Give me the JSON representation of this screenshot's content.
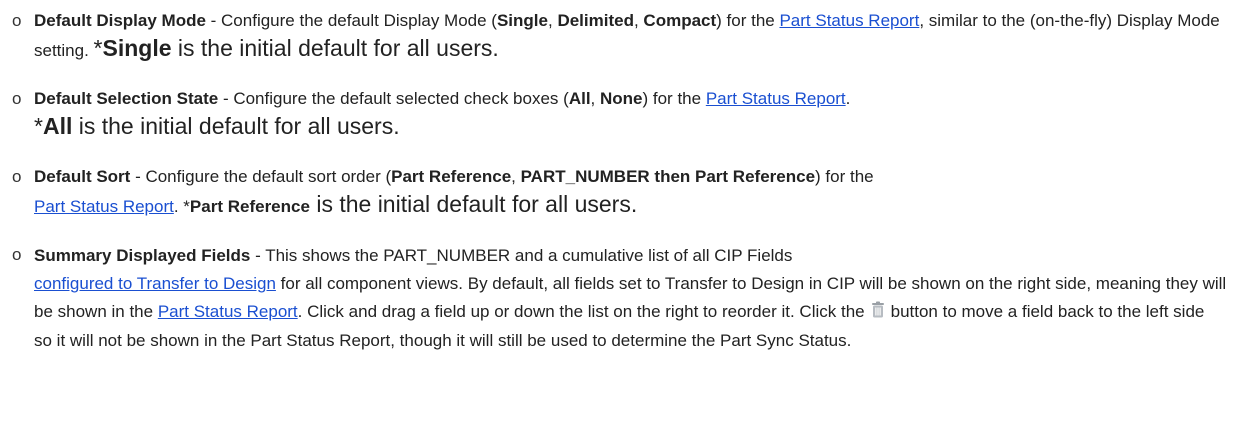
{
  "items": [
    {
      "title": "Default Display Mode",
      "sep": " - ",
      "t1": "Configure the default Display Mode (",
      "opt1": "Single",
      "c1": ", ",
      "opt2": "Delimited",
      "c2": ", ",
      "opt3": "Compact",
      "t2": ") for the ",
      "link": "Part Status Report",
      "t3": ", similar to the (on-the-fly) Display Mode setting. ",
      "note_prefix": "*",
      "note_bold": "Single",
      "note_rest": " is the initial default for all users."
    },
    {
      "title": "Default Selection State",
      "sep": " - ",
      "t1": "Configure the default selected check boxes (",
      "opt1": "All",
      "c1": ", ",
      "opt2": "None",
      "t2": ") for the ",
      "link": "Part Status Report",
      "t3": ".",
      "note_prefix": "*",
      "note_bold": "All",
      "note_rest": " is the initial default for all users."
    },
    {
      "title": "Default Sort",
      "sep": " - ",
      "t1": "Configure the default sort order (",
      "opt1": "Part Reference",
      "c1": ", ",
      "opt2": "PART_NUMBER then Part Reference",
      "t2": ") for the ",
      "link": "Part Status Report",
      "t3": ". ",
      "note_prefix": "*",
      "note_bold": "Part Reference",
      "note_rest": " is the initial default for all users."
    },
    {
      "title": "Summary Displayed Fields",
      "sep": " - ",
      "t1": "This shows the PART_NUMBER and a cumulative list of all CIP Fields ",
      "link1": "configured to Transfer to Design",
      "t2": " for all component views. By default, all fields set to Transfer to Design in CIP will be shown on the right side, meaning they will be shown in the ",
      "link2": "Part Status Report",
      "t3": ". Click and drag a field up or down the list on the right to reorder it. Click the",
      "t4": "button to move a field back to the left side so it will not be shown in the Part Status Report, though it will still be used to determine the Part Sync Status."
    }
  ],
  "bullet_glyph": "o",
  "colors": {
    "link": "#1a4fd1",
    "text": "#222222"
  }
}
